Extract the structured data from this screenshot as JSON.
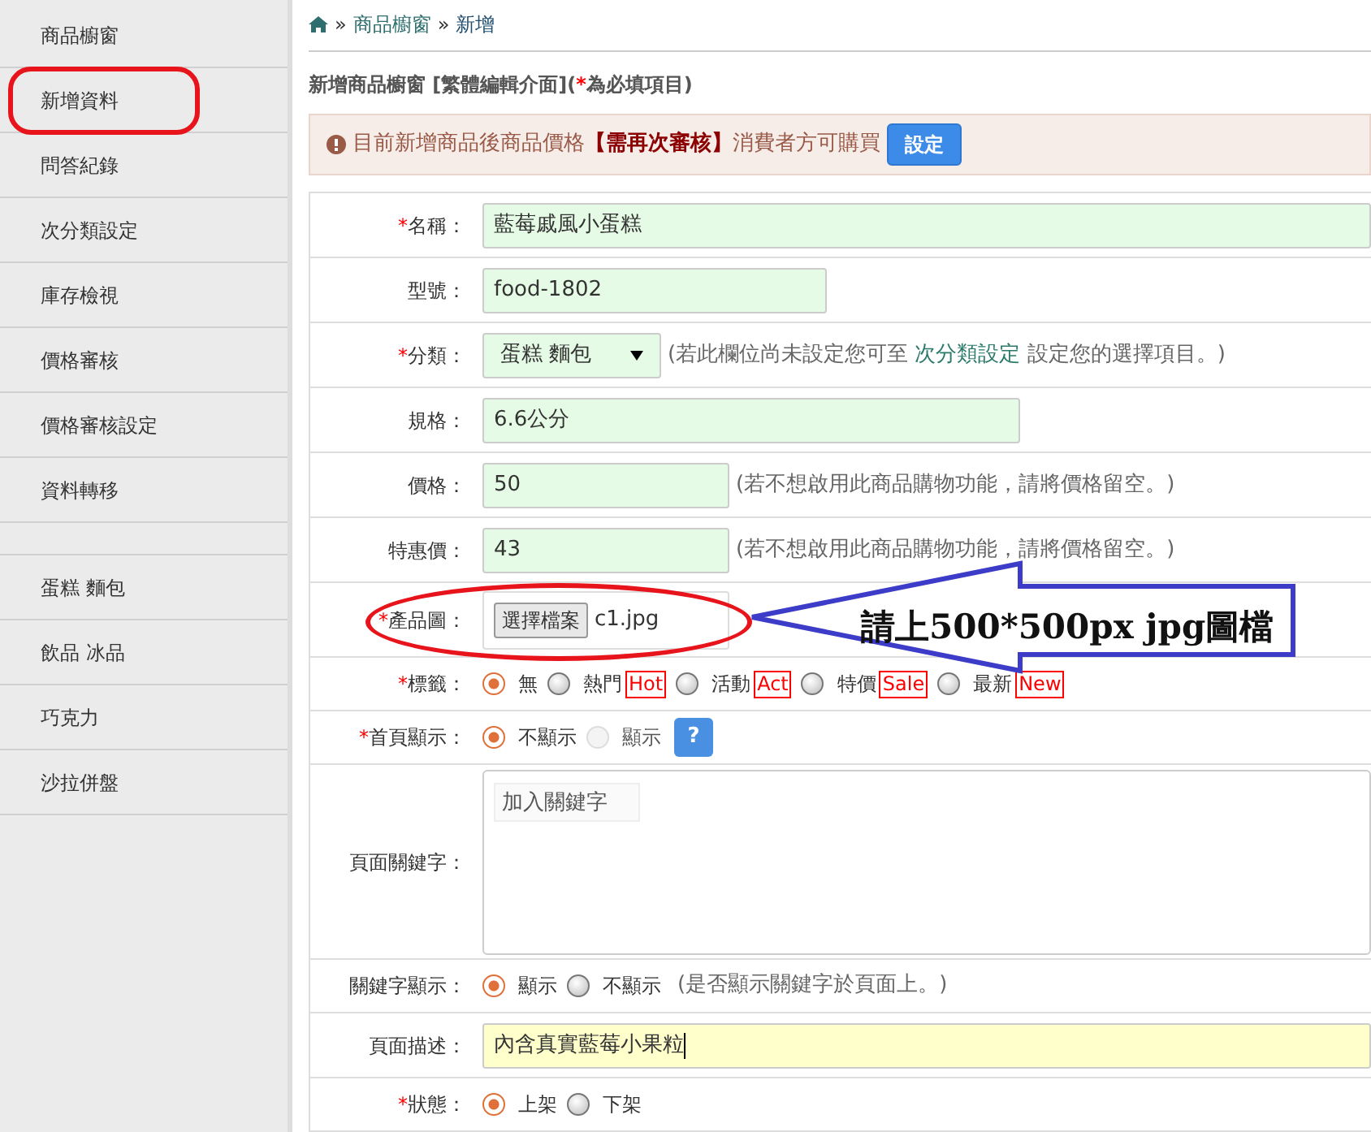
{
  "sidebar": {
    "items": [
      {
        "kind": "link",
        "label": "商品櫥窗"
      },
      {
        "kind": "link",
        "label": "新增資料"
      },
      {
        "kind": "link",
        "label": "問答紀錄"
      },
      {
        "kind": "link",
        "label": "次分類設定"
      },
      {
        "kind": "link",
        "label": "庫存檢視"
      },
      {
        "kind": "link",
        "label": "價格審核"
      },
      {
        "kind": "link",
        "label": "價格審核設定"
      },
      {
        "kind": "link",
        "label": "資料轉移"
      },
      {
        "kind": "spacer"
      },
      {
        "kind": "link",
        "label": "蛋糕 麵包"
      },
      {
        "kind": "link",
        "label": "飲品 冰品"
      },
      {
        "kind": "link",
        "label": "巧克力"
      },
      {
        "kind": "link",
        "label": "沙拉併盤"
      }
    ]
  },
  "breadcrumb": [
    {
      "kind": "home"
    },
    {
      "kind": "separator",
      "text": "»"
    },
    {
      "kind": "link",
      "text": "商品櫥窗"
    },
    {
      "kind": "separator",
      "text": "»"
    },
    {
      "kind": "current",
      "text": "新增"
    }
  ],
  "page_title": [
    {
      "kind": "text",
      "text": "新增商品櫥窗 [繁體編輯介面]("
    },
    {
      "kind": "required",
      "text": "*"
    },
    {
      "kind": "text",
      "text": "為必填項目)"
    }
  ],
  "alert": {
    "parts": [
      {
        "kind": "text",
        "text": "目前新增商品後商品價格"
      },
      {
        "kind": "highlight",
        "text": "【需再次審核】"
      },
      {
        "kind": "text",
        "text": "消費者方可購買"
      }
    ],
    "button": "設定"
  },
  "form": {
    "rows": [
      {
        "kind": "text",
        "label": "名稱：",
        "required": true,
        "value": "藍莓戚風小蛋糕",
        "focused": false
      },
      {
        "kind": "text",
        "label": "型號：",
        "required": false,
        "value": "food-1802",
        "focused": false
      },
      {
        "kind": "select",
        "label": "分類：",
        "required": true,
        "value": "蛋糕 麵包",
        "hint": [
          {
            "kind": "text",
            "text": "(若此欄位尚未設定您可至 "
          },
          {
            "kind": "link",
            "text": "次分類設定"
          },
          {
            "kind": "text",
            "text": " 設定您的選擇項目。)"
          }
        ]
      },
      {
        "kind": "text",
        "label": "規格：",
        "required": false,
        "value": "6.6公分",
        "focused": false
      },
      {
        "kind": "text",
        "label": "價格：",
        "required": false,
        "value": "50",
        "focused": false,
        "hint": [
          {
            "kind": "text",
            "text": "(若不想啟用此商品購物功能，請將價格留空。)"
          }
        ]
      },
      {
        "kind": "text",
        "label": "特惠價：",
        "required": false,
        "value": "43",
        "focused": false,
        "hint": [
          {
            "kind": "text",
            "text": "(若不想啟用此商品購物功能，請將價格留空。)"
          }
        ]
      },
      {
        "kind": "file",
        "label": "產品圖：",
        "required": true,
        "button": "選擇檔案",
        "value": "c1.jpg"
      },
      {
        "kind": "radio",
        "label": "標籤：",
        "required": true,
        "options": [
          {
            "label": "無",
            "selected": true,
            "disabled": false
          },
          {
            "label": "熱門",
            "tag": "Hot",
            "selected": false,
            "disabled": false
          },
          {
            "label": "活動",
            "tag": "Act",
            "selected": false,
            "disabled": false
          },
          {
            "label": "特價",
            "tag": "Sale",
            "selected": false,
            "disabled": false
          },
          {
            "label": "最新",
            "tag": "New",
            "selected": false,
            "disabled": false
          }
        ]
      },
      {
        "kind": "radio",
        "label": "首頁顯示：",
        "required": true,
        "options": [
          {
            "label": "不顯示",
            "selected": true,
            "disabled": false
          },
          {
            "label": "顯示",
            "selected": false,
            "disabled": true
          }
        ],
        "help_button": "?"
      },
      {
        "kind": "tags",
        "label": "頁面關鍵字：",
        "required": false,
        "placeholder": "加入關鍵字"
      },
      {
        "kind": "radio",
        "label": "關鍵字顯示：",
        "required": false,
        "options": [
          {
            "label": "顯示",
            "selected": true,
            "disabled": false
          },
          {
            "label": "不顯示",
            "selected": false,
            "disabled": false
          }
        ],
        "hint": [
          {
            "kind": "text",
            "text": "(是否顯示關鍵字於頁面上。)"
          }
        ]
      },
      {
        "kind": "text",
        "label": "頁面描述：",
        "required": false,
        "value": "內含真實藍莓小果粒",
        "focused": true
      },
      {
        "kind": "radio",
        "label": "狀態：",
        "required": true,
        "options": [
          {
            "label": "上架",
            "selected": true,
            "disabled": false
          },
          {
            "label": "下架",
            "selected": false,
            "disabled": false
          }
        ]
      }
    ]
  },
  "annotation": {
    "callout": "請上500*500px jpg圖檔"
  }
}
